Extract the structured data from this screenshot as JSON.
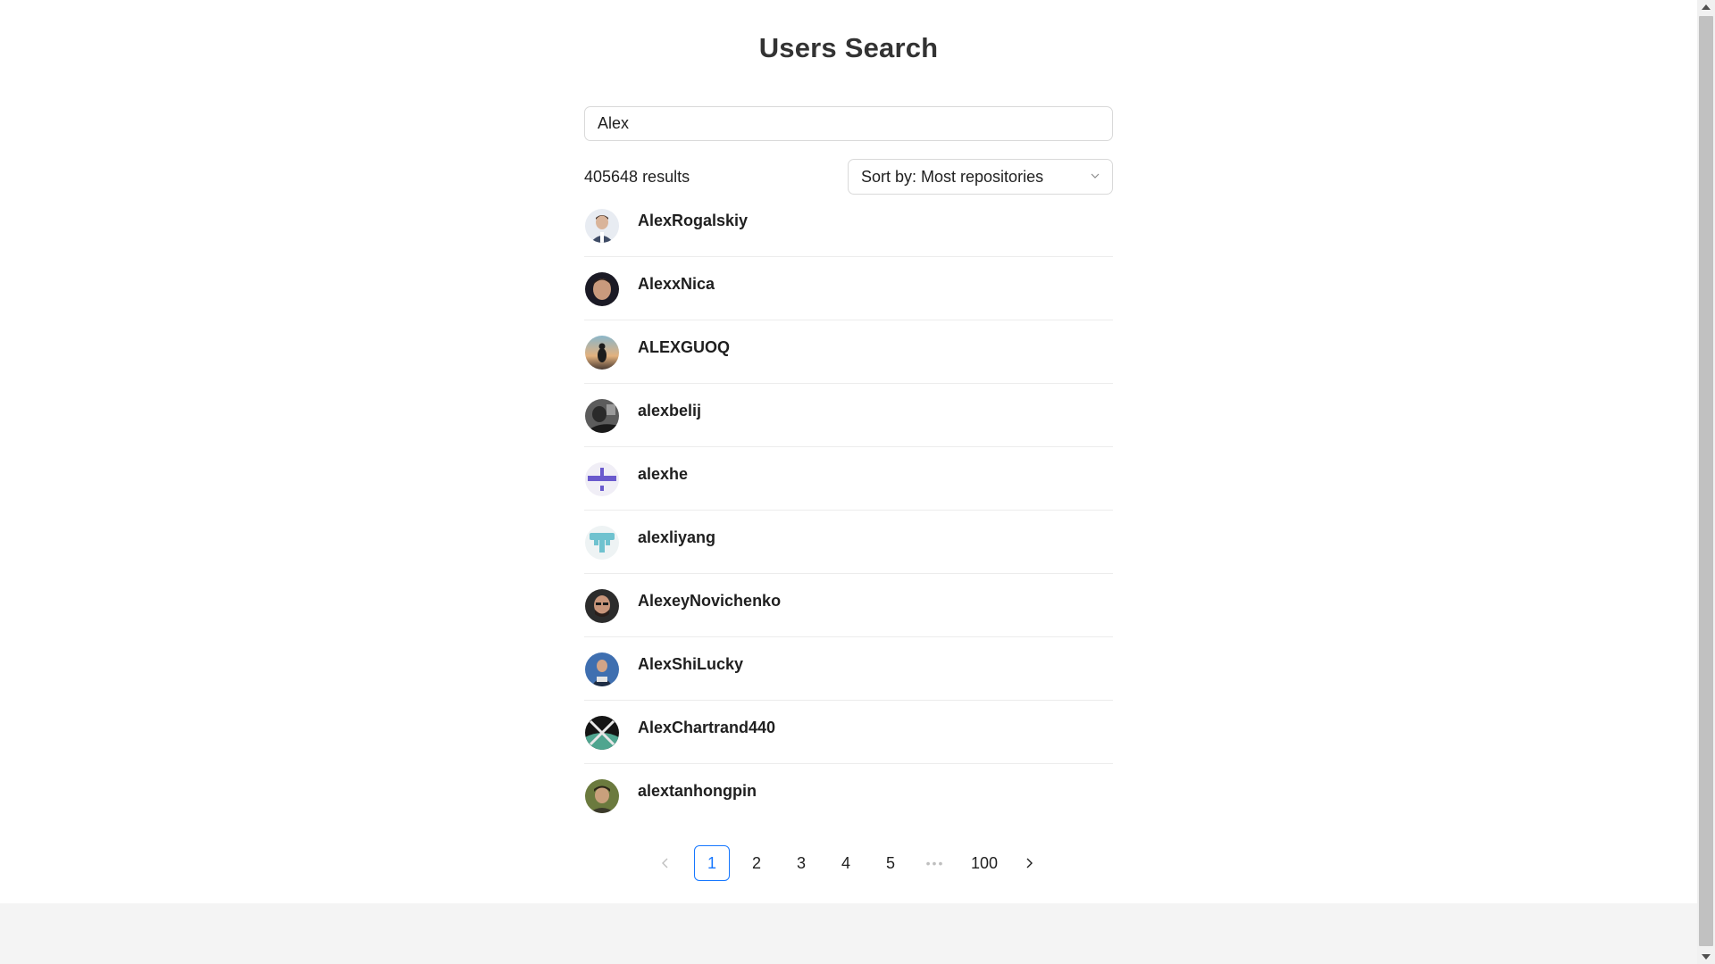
{
  "page": {
    "title": "Users Search"
  },
  "search": {
    "value": "Alex"
  },
  "results": {
    "count_text": "405648 results"
  },
  "sort": {
    "selected": "Sort by: Most repositories"
  },
  "users": [
    {
      "login": "AlexRogalskiy"
    },
    {
      "login": "AlexxNica"
    },
    {
      "login": "ALEXGUOQ"
    },
    {
      "login": "alexbelij"
    },
    {
      "login": "alexhe"
    },
    {
      "login": "alexliyang"
    },
    {
      "login": "AlexeyNovichenko"
    },
    {
      "login": "AlexShiLucky"
    },
    {
      "login": "AlexChartrand440"
    },
    {
      "login": "alextanhongpin"
    }
  ],
  "pagination": {
    "prev": "<",
    "pages": [
      "1",
      "2",
      "3",
      "4",
      "5"
    ],
    "ellipsis": "•••",
    "last": "100",
    "next": ">",
    "current": "1"
  },
  "colors": {
    "accent": "#1677ff",
    "border": "#d9d9d9",
    "footer": "#f4f4f4"
  },
  "icons": {
    "sort_chevron": "chevron-down-icon",
    "prev": "chevron-left-icon",
    "next": "chevron-right-icon"
  }
}
